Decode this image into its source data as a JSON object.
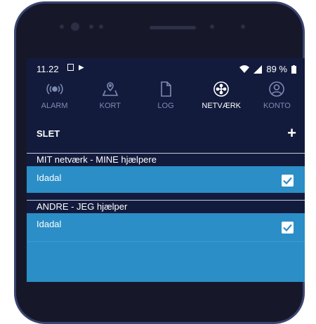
{
  "status_bar": {
    "time": "11.22",
    "battery": "89 %"
  },
  "tabs": [
    {
      "label": "ALARM",
      "icon": "alarm-icon"
    },
    {
      "label": "KORT",
      "icon": "map-icon"
    },
    {
      "label": "LOG",
      "icon": "document-icon"
    },
    {
      "label": "NETVÆRK",
      "icon": "network-icon",
      "active": true
    },
    {
      "label": "KONTO",
      "icon": "account-icon"
    }
  ],
  "toolbar": {
    "delete_label": "SLET",
    "add_label": "+"
  },
  "sections": [
    {
      "header": "MIT netværk - MINE hjælpere",
      "items": [
        {
          "name": "Idadal",
          "checked": true
        }
      ]
    },
    {
      "header": "ANDRE - JEG hjælper",
      "items": [
        {
          "name": "Idadal",
          "checked": true
        }
      ]
    }
  ],
  "colors": {
    "background": "#131b3d",
    "row": "#2b8ec6",
    "tab_inactive": "#7e8bb3",
    "tab_active": "#ffffff"
  }
}
